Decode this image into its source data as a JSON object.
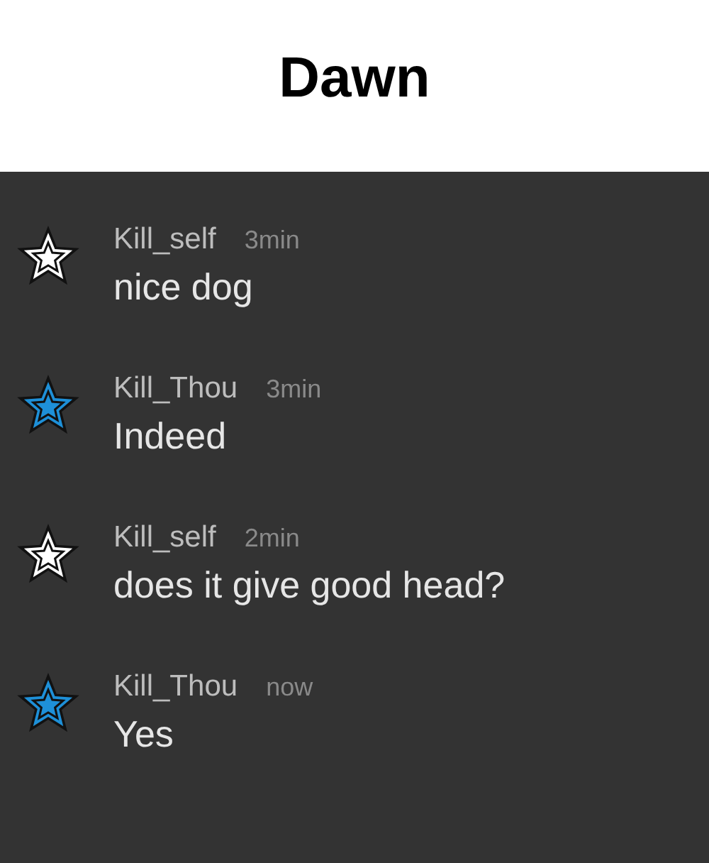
{
  "title": "Dawn",
  "messages": [
    {
      "author": "Kill_self",
      "time": "3min",
      "text": "nice dog",
      "color": "#ffffff"
    },
    {
      "author": "Kill_Thou",
      "time": "3min",
      "text": "Indeed",
      "color": "#1e90d8"
    },
    {
      "author": "Kill_self",
      "time": "2min",
      "text": "does it give good head?",
      "color": "#ffffff"
    },
    {
      "author": "Kill_Thou",
      "time": "now",
      "text": "Yes",
      "color": "#1e90d8"
    }
  ]
}
